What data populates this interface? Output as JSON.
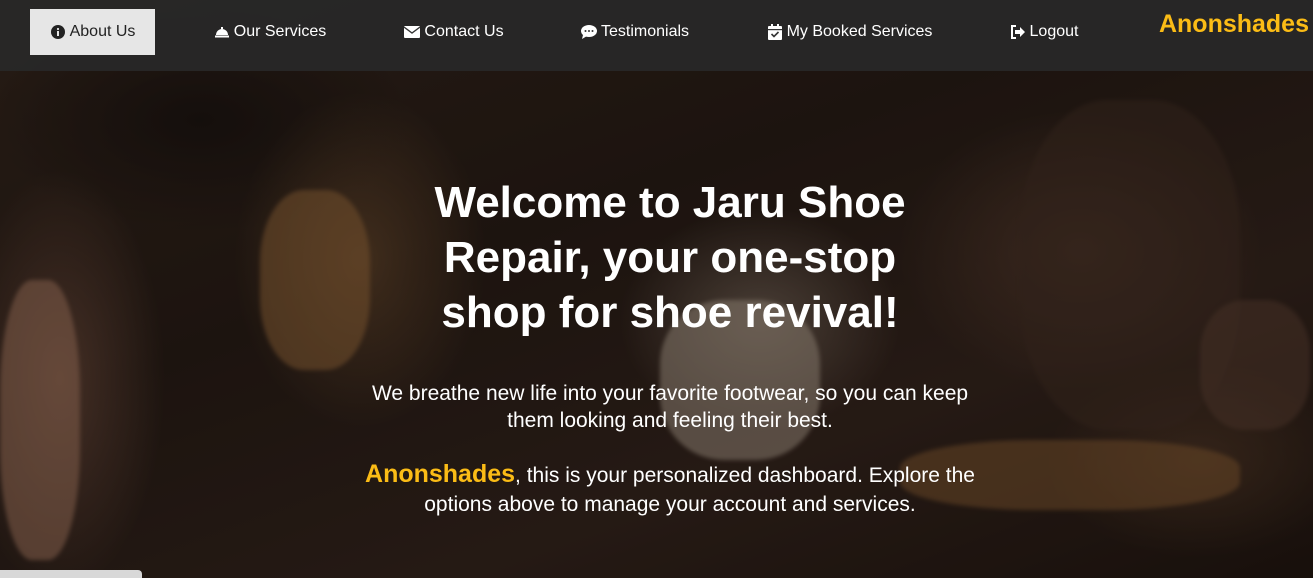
{
  "nav": {
    "items": [
      {
        "label": "About Us",
        "icon": "info-circle-icon"
      },
      {
        "label": "Our Services",
        "icon": "bell-service-icon"
      },
      {
        "label": "Contact Us",
        "icon": "envelope-icon"
      },
      {
        "label": "Testimonials",
        "icon": "comment-dots-icon"
      },
      {
        "label": "My Booked Services",
        "icon": "calendar-check-icon"
      },
      {
        "label": "Logout",
        "icon": "sign-out-icon"
      }
    ],
    "brand": "Anonshades"
  },
  "hero": {
    "title": "Welcome to Jaru Shoe Repair, your one-stop shop for shoe revival!",
    "lead": "We breathe new life into your favorite footwear, so you can keep them looking and feeling their best.",
    "username": "Anonshades",
    "message": ", this is your personalized dashboard. Explore the options above to manage your account and services."
  },
  "colors": {
    "accent": "#fbbc16",
    "navbar": "#282828",
    "active_tab": "#e6e6e6"
  }
}
